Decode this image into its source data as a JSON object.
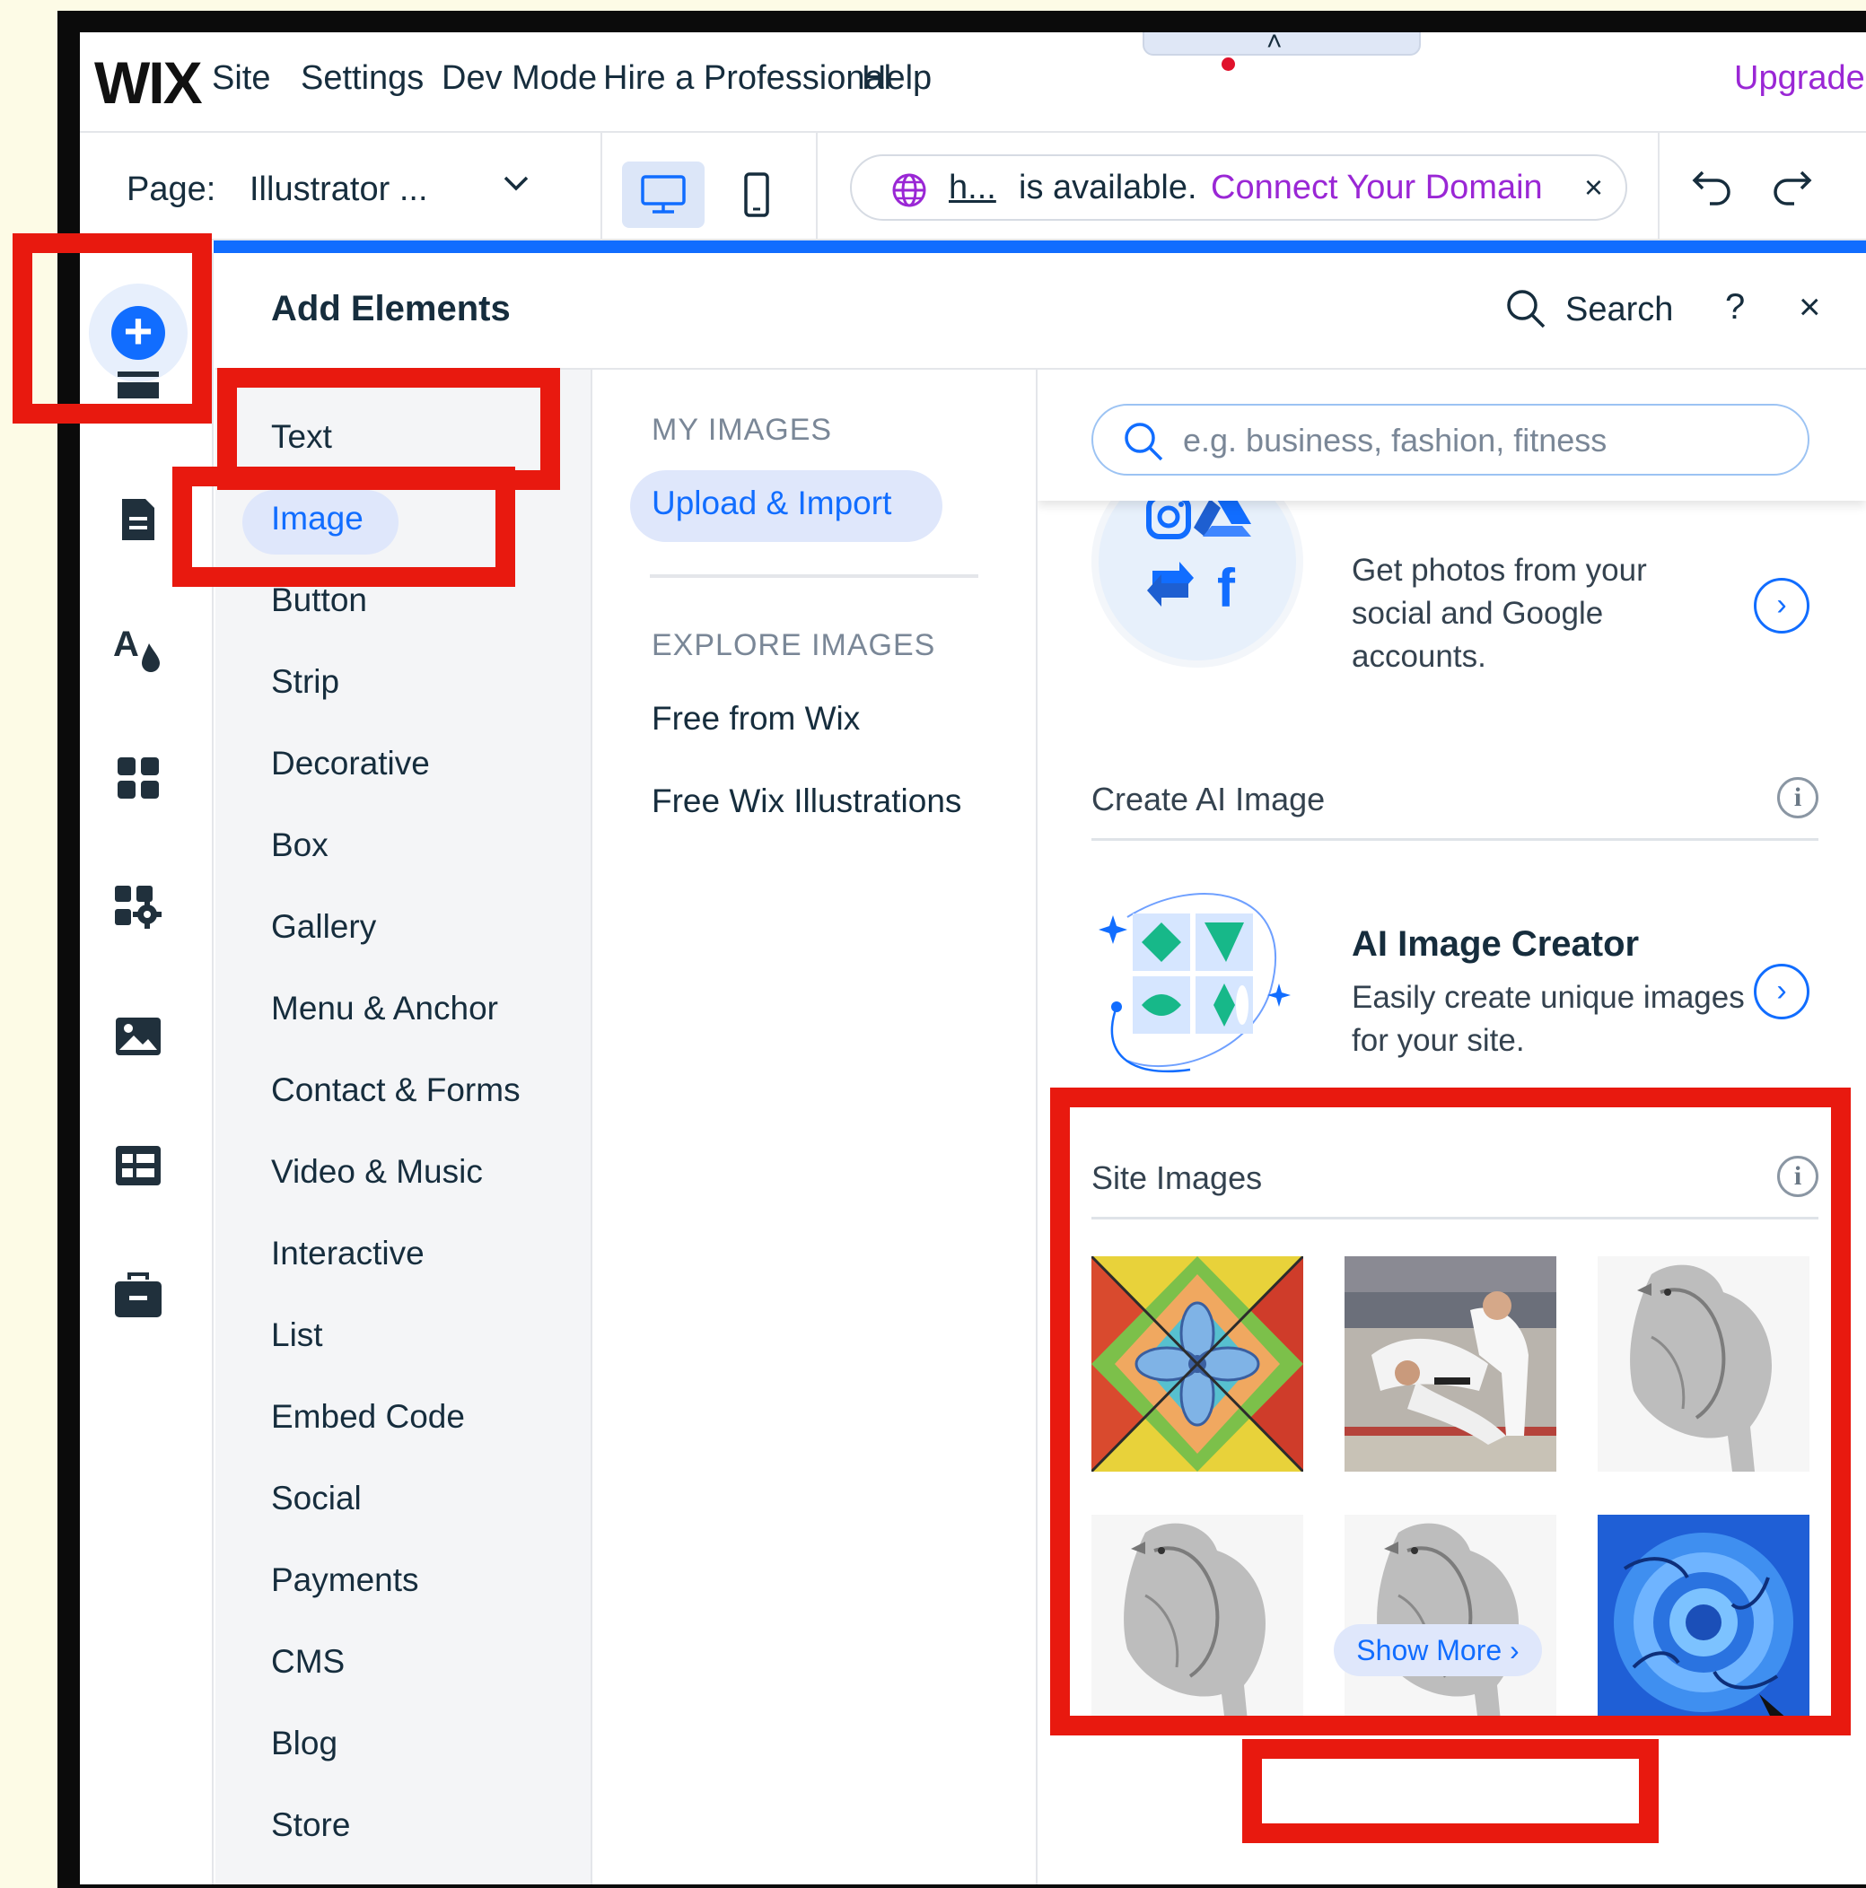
{
  "topbar": {
    "logo": "WIX",
    "menu": [
      "Site",
      "Settings",
      "Dev Mode",
      "Hire a Professional",
      "Help"
    ],
    "upgrade": "Upgrade",
    "collapse_caret": "˄"
  },
  "pagebar": {
    "page_label": "Page:",
    "page_value": "Illustrator ...",
    "domain_short": "h...",
    "domain_status": "is available.",
    "domain_cta": "Connect Your Domain",
    "domain_close": "×"
  },
  "panel": {
    "title": "Add Elements",
    "search_label": "Search",
    "help": "?",
    "close": "×",
    "categories": [
      "Text",
      "Image",
      "Button",
      "Strip",
      "Decorative",
      "Box",
      "Gallery",
      "Menu & Anchor",
      "Contact & Forms",
      "Video & Music",
      "Interactive",
      "List",
      "Embed Code",
      "Social",
      "Payments",
      "CMS",
      "Blog",
      "Store"
    ],
    "selected_category": "Image"
  },
  "subnav": {
    "my_images_heading": "MY IMAGES",
    "upload_label": "Upload & Import",
    "explore_heading": "EXPLORE IMAGES",
    "links": [
      "Free from Wix",
      "Free Wix Illustrations"
    ]
  },
  "content": {
    "search_placeholder": "e.g. business, fashion, fitness",
    "social_desc": "Get photos from your social and Google accounts.",
    "create_ai_title": "Create AI Image",
    "ai_creator_title": "AI Image Creator",
    "ai_creator_desc": "Easily create unique images for your site.",
    "site_images_title": "Site Images",
    "info_glyph": "i",
    "arrow_glyph": "›",
    "show_more": "Show More ›",
    "site_images": [
      "stained-glass-pattern",
      "martial-arts-throw",
      "bird-sketch",
      "bird-sketch",
      "bird-sketch",
      "blue-rose"
    ]
  },
  "colors": {
    "accent": "#116dff",
    "upgrade": "#9a27d5",
    "annotation": "#e8190f",
    "background": "#fdfbe6"
  }
}
